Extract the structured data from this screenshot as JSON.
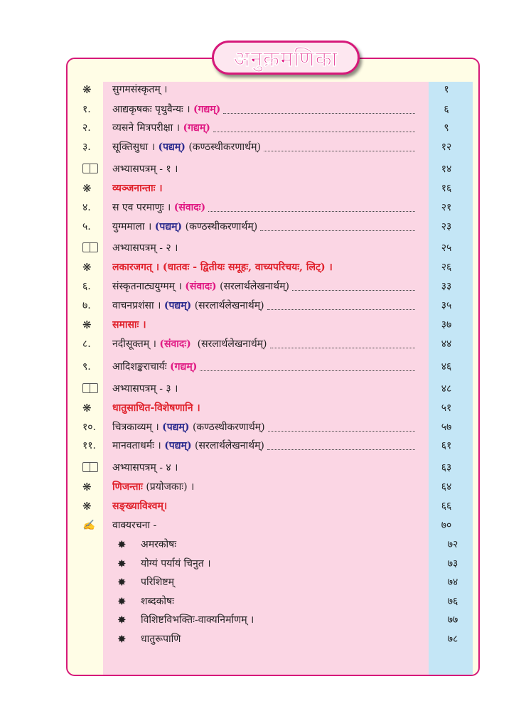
{
  "title": "अनुक्रमणिका",
  "entries": [
    {
      "num": "❋",
      "parts": [
        {
          "t": "सुगमसंस्कृतम् ।",
          "c": ""
        }
      ],
      "dots": false,
      "page": "१"
    },
    {
      "num": "१.",
      "parts": [
        {
          "t": "आद्यकृषकः पृथुवैन्यः । ",
          "c": ""
        },
        {
          "t": "(गद्यम्)",
          "c": "pink"
        }
      ],
      "dots": true,
      "page": "६"
    },
    {
      "num": "२.",
      "parts": [
        {
          "t": "व्यसने मित्रपरीक्षा । ",
          "c": ""
        },
        {
          "t": "(गद्यम्)",
          "c": "pink"
        }
      ],
      "dots": true,
      "page": "९"
    },
    {
      "num": "३.",
      "parts": [
        {
          "t": "सूक्तिसुधा । ",
          "c": ""
        },
        {
          "t": "(पद्यम्)",
          "c": "blue"
        },
        {
          "t": " (कण्ठस्थीकरणार्थम्)",
          "c": ""
        }
      ],
      "dots": true,
      "page": "१२"
    },
    {
      "num": "BOOK",
      "parts": [
        {
          "t": "अभ्यासपत्रम् - १ ।",
          "c": ""
        }
      ],
      "dots": false,
      "page": "१४"
    },
    {
      "num": "❋",
      "parts": [
        {
          "t": "व्यञ्जनान्ताः ।",
          "c": "red"
        }
      ],
      "dots": false,
      "page": "१६"
    },
    {
      "num": "४.",
      "parts": [
        {
          "t": "स एव परमाणुः । ",
          "c": ""
        },
        {
          "t": "(संवादः)",
          "c": "pink"
        }
      ],
      "dots": true,
      "page": "२१"
    },
    {
      "num": "५.",
      "parts": [
        {
          "t": "युग्ममाला । ",
          "c": ""
        },
        {
          "t": "(पद्यम्)",
          "c": "blue"
        },
        {
          "t": " (कण्ठस्थीकरणार्थम्)",
          "c": ""
        }
      ],
      "dots": true,
      "page": "२३"
    },
    {
      "num": "BOOK",
      "parts": [
        {
          "t": "अभ्यासपत्रम् - २ ।",
          "c": ""
        }
      ],
      "dots": false,
      "page": "२५"
    },
    {
      "num": "❋",
      "parts": [
        {
          "t": "लकारजगत् । (धातवः - द्वितीयः समूहः, वाच्यपरिचयः, लिट्) ।",
          "c": "red"
        }
      ],
      "dots": false,
      "page": "२६"
    },
    {
      "num": "६.",
      "parts": [
        {
          "t": "संस्कृतनाट्ययुग्मम् । ",
          "c": ""
        },
        {
          "t": "(संवादः)",
          "c": "pink"
        },
        {
          "t": " (सरलार्थलेखनार्थम्)",
          "c": ""
        }
      ],
      "dots": true,
      "page": "३३"
    },
    {
      "num": "७.",
      "parts": [
        {
          "t": "वाचनप्रशंसा । ",
          "c": ""
        },
        {
          "t": "(पद्यम्)",
          "c": "blue"
        },
        {
          "t": " (सरलार्थलेखनार्थम्)",
          "c": ""
        }
      ],
      "dots": true,
      "page": "३५"
    },
    {
      "num": "❋",
      "parts": [
        {
          "t": "समासाः ।",
          "c": "red"
        }
      ],
      "dots": false,
      "page": "३७"
    },
    {
      "num": "८.",
      "parts": [
        {
          "t": "नदीसूक्तम् । ",
          "c": ""
        },
        {
          "t": "(संवादः)",
          "c": "pink"
        },
        {
          "t": "  (सरलार्थलेखनार्थम्)",
          "c": ""
        }
      ],
      "dots": true,
      "page": "४४"
    },
    {
      "num": "९.",
      "parts": [
        {
          "t": "आदिशङ्कराचार्यः ",
          "c": ""
        },
        {
          "t": "(गद्यम्)",
          "c": "pink"
        }
      ],
      "dots": true,
      "page": "४६"
    },
    {
      "num": "BOOK",
      "parts": [
        {
          "t": "अभ्यासपत्रम् - ३ ।",
          "c": ""
        }
      ],
      "dots": false,
      "page": "४८"
    },
    {
      "num": "❋",
      "parts": [
        {
          "t": "धातुसाधित-विशेषणानि ।",
          "c": "red"
        }
      ],
      "dots": false,
      "page": "५१"
    },
    {
      "num": "१०.",
      "parts": [
        {
          "t": "चित्रकाव्यम् । ",
          "c": ""
        },
        {
          "t": "(पद्यम्)",
          "c": "blue"
        },
        {
          "t": " (कण्ठस्थीकरणार्थम्)",
          "c": ""
        }
      ],
      "dots": true,
      "page": "५७"
    },
    {
      "num": "११.",
      "parts": [
        {
          "t": "मानवताधर्मः । ",
          "c": ""
        },
        {
          "t": "(पद्यम्)",
          "c": "blue"
        },
        {
          "t": " (सरलार्थलेखनार्थम्)",
          "c": ""
        }
      ],
      "dots": true,
      "page": "६१"
    },
    {
      "num": "BOOK",
      "parts": [
        {
          "t": "अभ्यासपत्रम् - ४ ।",
          "c": ""
        }
      ],
      "dots": false,
      "page": "६३"
    },
    {
      "num": "❋",
      "parts": [
        {
          "t": "णिजन्ताः",
          "c": "red"
        },
        {
          "t": " (प्रयोजकाः) ।",
          "c": ""
        }
      ],
      "dots": false,
      "page": "६४"
    },
    {
      "num": "❋",
      "parts": [
        {
          "t": "सङ्ख्याविश्वम्।",
          "c": "red"
        }
      ],
      "dots": false,
      "page": "६६"
    },
    {
      "num": "PEN",
      "parts": [
        {
          "t": "वाक्यरचना -",
          "c": ""
        }
      ],
      "dots": false,
      "page": "७०"
    }
  ],
  "sub_entries": [
    {
      "text": "अमरकोषः",
      "page": "७२"
    },
    {
      "text": "योग्यं पर्यायं चिनुत ।",
      "page": "७३"
    },
    {
      "text": "परिशिष्टम्",
      "page": "७४"
    },
    {
      "text": "शब्दकोषः",
      "page": "७६"
    },
    {
      "text": "विशिष्टविभक्तिः-वाक्यनिर्माणम् ।",
      "page": "७७"
    },
    {
      "text": "धातुरूपाणि",
      "page": "७८"
    }
  ],
  "sub_marker": "✸",
  "pen_icon": "✍"
}
